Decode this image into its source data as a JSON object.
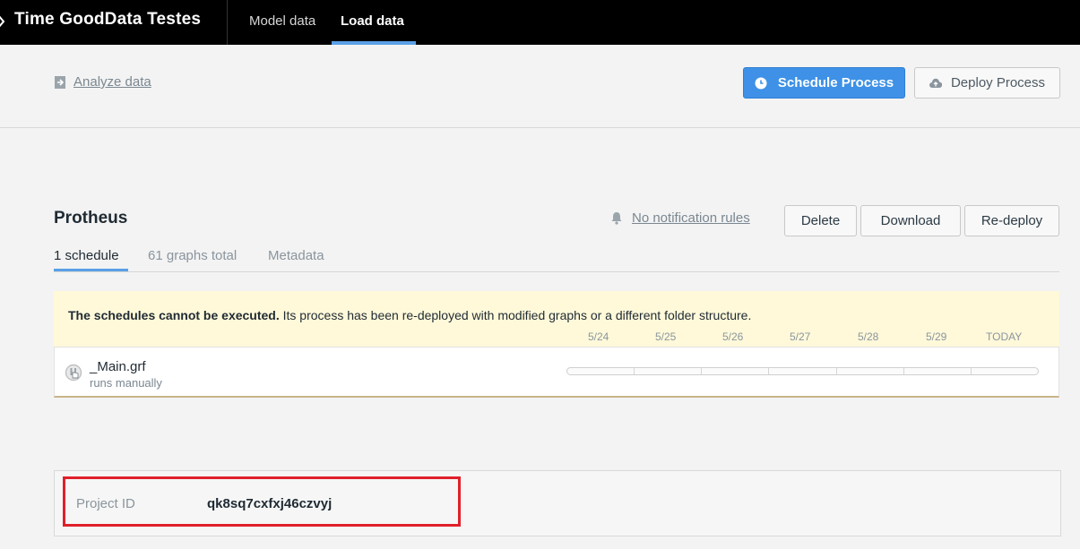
{
  "topbar": {
    "project_title": "Time GoodData Testes",
    "nav": [
      {
        "label": "Model data",
        "active": false
      },
      {
        "label": "Load data",
        "active": true
      }
    ]
  },
  "header": {
    "analyze_link": "Analyze data",
    "schedule_button": "Schedule Process",
    "deploy_button": "Deploy Process"
  },
  "process": {
    "name": "Protheus",
    "notification_link": "No notification rules",
    "actions": {
      "delete": "Delete",
      "download": "Download",
      "redeploy": "Re-deploy"
    },
    "tabs": [
      {
        "label": "1 schedule",
        "active": true
      },
      {
        "label": "61 graphs total",
        "active": false
      },
      {
        "label": "Metadata",
        "active": false
      }
    ]
  },
  "warning": {
    "bold": "The schedules cannot be executed.",
    "text": " Its process has been re-deployed with modified graphs or a different folder structure."
  },
  "timeline": {
    "dates": [
      "5/24",
      "5/25",
      "5/26",
      "5/27",
      "5/28",
      "5/29",
      "TODAY"
    ]
  },
  "schedule": {
    "name": "_Main.grf",
    "subtitle": "runs manually"
  },
  "project": {
    "label": "Project ID",
    "value": "qk8sq7cxfxj46czvyj"
  },
  "colors": {
    "accent": "#3e91e6",
    "warning_bg": "#fff9d9",
    "highlight": "#e0202a"
  }
}
